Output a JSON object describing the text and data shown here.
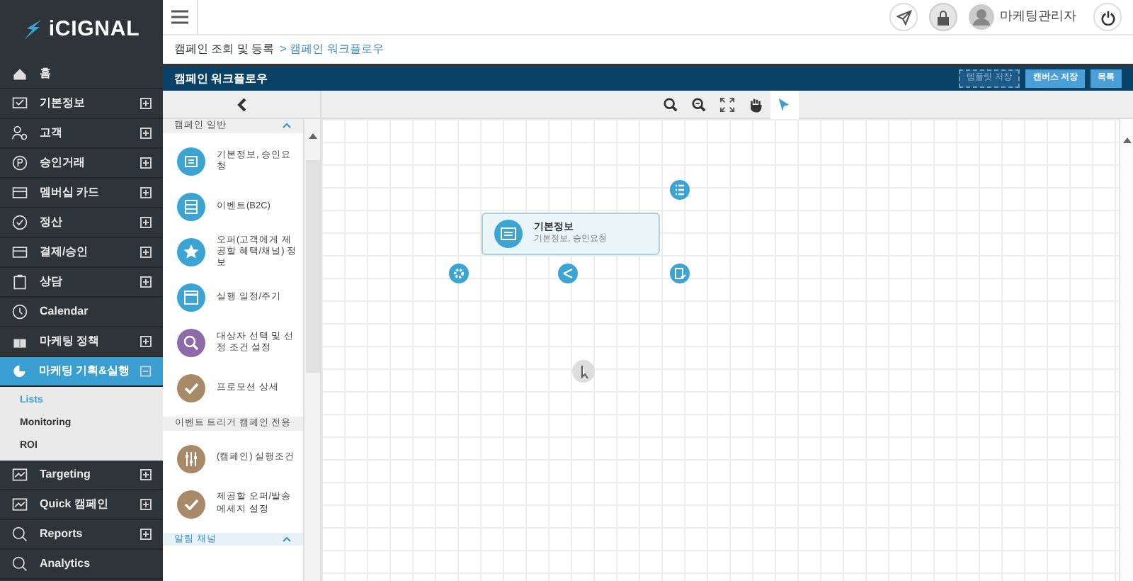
{
  "logo": {
    "text": "iCIGNAL"
  },
  "sidebar": {
    "items": [
      {
        "label": "홈",
        "expandable": false,
        "selected": false
      },
      {
        "label": "기본정보",
        "expandable": true,
        "expanded": false,
        "selected": false
      },
      {
        "label": "고객",
        "expandable": true,
        "expanded": false,
        "selected": false
      },
      {
        "label": "승인거래",
        "expandable": true,
        "expanded": false,
        "selected": false
      },
      {
        "label": "멤버십 카드",
        "expandable": true,
        "expanded": false,
        "selected": false
      },
      {
        "label": "정산",
        "expandable": true,
        "expanded": false,
        "selected": false
      },
      {
        "label": "결제/승인",
        "expandable": true,
        "expanded": false,
        "selected": false
      },
      {
        "label": "상담",
        "expandable": true,
        "expanded": false,
        "selected": false
      },
      {
        "label": "Calendar",
        "expandable": false,
        "selected": false
      },
      {
        "label": "마케팅 정책",
        "expandable": true,
        "expanded": false,
        "selected": false
      },
      {
        "label": "마케팅 기획&실행",
        "expandable": true,
        "expanded": true,
        "selected": true,
        "children": [
          {
            "label": "Lists",
            "selected": true
          },
          {
            "label": "Monitoring",
            "selected": false
          },
          {
            "label": "ROI",
            "selected": false
          }
        ]
      },
      {
        "label": "Targeting",
        "expandable": true,
        "expanded": false,
        "selected": false
      },
      {
        "label": "Quick 캠페인",
        "expandable": true,
        "expanded": false,
        "selected": false
      },
      {
        "label": "Reports",
        "expandable": true,
        "expanded": false,
        "selected": false
      },
      {
        "label": "Analytics",
        "expandable": false,
        "selected": false
      }
    ]
  },
  "header": {
    "user": "마케팅관리자"
  },
  "breadcrumb": [
    "캠페인 조회 및 등록",
    "> 캠페인 워크플로우"
  ],
  "title_bar": {
    "title": "캠페인 워크플로우",
    "buttons": [
      {
        "label": "템플릿 저장",
        "disabled": true
      },
      {
        "label": "캔버스 저장",
        "disabled": false
      },
      {
        "label": "목록",
        "disabled": false
      }
    ]
  },
  "toolbar": {
    "tools": [
      {
        "kind": "zoom-in",
        "selected": false
      },
      {
        "kind": "zoom-out",
        "selected": false
      },
      {
        "kind": "fit",
        "selected": false
      },
      {
        "kind": "hand",
        "selected": false
      },
      {
        "kind": "pointer",
        "selected": true
      }
    ]
  },
  "palette": {
    "sections": [
      {
        "title": "캠페인 일반",
        "collapsible": true,
        "items": [
          {
            "label": "기본정보, 승인요청",
            "color": "#3ba4d3"
          },
          {
            "label": "이벤트(B2C)",
            "color": "#3ba4d3"
          },
          {
            "label": "오퍼(고객에게 제공할 혜택/채널) 정보",
            "color": "#3ba4d3"
          },
          {
            "label": "실행 일정/주기",
            "color": "#3ba4d3"
          },
          {
            "label": "대상자 선택 및 선정 조건 설정",
            "color": "#8d6aa9"
          },
          {
            "label": "프로모션 상세",
            "color": "#a88a68"
          }
        ]
      },
      {
        "title": "이벤트 트리거 캠페인 전용",
        "collapsible": false,
        "items": [
          {
            "label": "(캠페인) 실행조건",
            "color": "#a88a68"
          },
          {
            "label": "제공할 오퍼/발송 메세지 설정",
            "color": "#a88a68"
          }
        ]
      },
      {
        "title": "알림 채널",
        "collapsible": true
      }
    ]
  },
  "canvas": {
    "node": {
      "title": "기본정보",
      "subtitle": "기본정보, 승인요청"
    }
  }
}
